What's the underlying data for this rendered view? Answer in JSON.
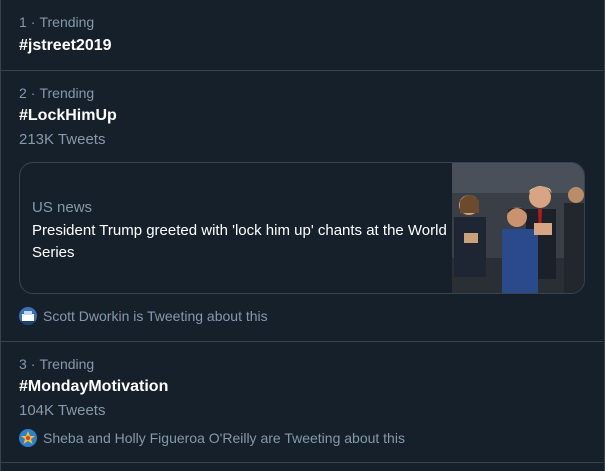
{
  "trends": [
    {
      "rank": "1",
      "separator": "·",
      "label": "Trending",
      "hashtag": "#jstreet2019"
    },
    {
      "rank": "2",
      "separator": "·",
      "label": "Trending",
      "hashtag": "#LockHimUp",
      "tweet_count": "213K Tweets",
      "card": {
        "category": "US news",
        "headline": "President Trump greeted with 'lock him up' chants at the World Series"
      },
      "context": "Scott Dworkin is Tweeting about this"
    },
    {
      "rank": "3",
      "separator": "·",
      "label": "Trending",
      "hashtag": "#MondayMotivation",
      "tweet_count": "104K Tweets",
      "context": "Sheba and Holly Figueroa O'Reilly are Tweeting about this"
    }
  ],
  "colors": {
    "background": "#15202b",
    "border": "#38444d",
    "secondary_text": "#8899a6",
    "primary_text": "#ffffff"
  }
}
